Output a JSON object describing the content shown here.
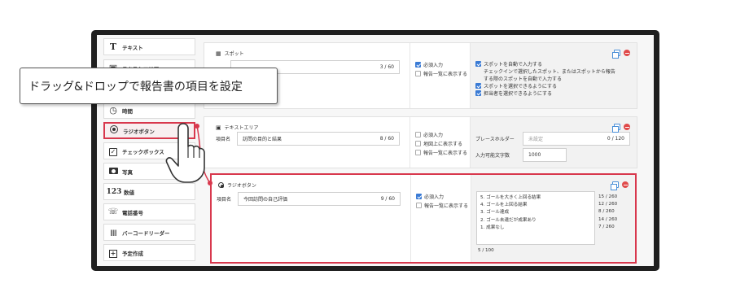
{
  "callout": {
    "text": "ドラッグ&ドロップで報告書の項目を設定"
  },
  "palette": {
    "items": [
      {
        "icon": "text-T-icon",
        "label": "テキスト"
      },
      {
        "icon": "textarea-icon",
        "label": "テキストエリア"
      },
      {
        "icon": "clock-icon",
        "label": "時間"
      },
      {
        "icon": "radio-icon",
        "label": "ラジオボタン"
      },
      {
        "icon": "checkbox-icon",
        "label": "チェックボックス"
      },
      {
        "icon": "camera-icon",
        "label": "写真"
      },
      {
        "icon": "number-icon",
        "label": "数値"
      },
      {
        "icon": "phone-icon",
        "label": "電話番号"
      },
      {
        "icon": "barcode-icon",
        "label": "バーコードリーダー"
      },
      {
        "icon": "schedule-icon",
        "label": "予定作成"
      }
    ],
    "glyphs": {
      "text": "T",
      "number": "123",
      "barcode": "|||||",
      "schedule": "+"
    }
  },
  "spot_card": {
    "title": "スポット",
    "count": "3 / 60",
    "required_label": "必須入力",
    "list_label": "報告一覧に表示する",
    "options": [
      "スポットを自動で入力する",
      "チェックインで選択したスポット、またはスポットから報告",
      "する際のスポットを自動で入力する",
      "スポットを選択できるようにする",
      "担当者を選択できるようにする"
    ]
  },
  "textarea_card": {
    "title": "テキストエリア",
    "item_label": "項目名",
    "item_value": "訪問の目的と結果",
    "count": "8 / 60",
    "required_label": "必須入力",
    "map_label": "地図上に表示する",
    "list_label": "報告一覧に表示する",
    "placeholder_label": "プレースホルダー",
    "placeholder_value": "未設定",
    "placeholder_count": "0 / 120",
    "maxlen_label": "入力可能文字数",
    "maxlen_value": "1000"
  },
  "radio_card": {
    "title": "ラジオボタン",
    "item_label": "項目名",
    "item_value": "今回訪問の自己評価",
    "count": "9 / 60",
    "required_label": "必須入力",
    "list_label": "報告一覧に表示する",
    "choices": [
      {
        "text": "5. ゴールを大きく上回る結果",
        "count": "15 / 260"
      },
      {
        "text": "4. ゴールを上回る結果",
        "count": "12 / 260"
      },
      {
        "text": "3. ゴール達成",
        "count": "8 / 260"
      },
      {
        "text": "2. ゴール未達だが成果あり",
        "count": "14 / 260"
      },
      {
        "text": "1. 成果なし",
        "count": "7 / 260"
      }
    ],
    "total": "5 / 100"
  },
  "colors": {
    "highlight": "#d8384d",
    "checkbox": "#3a7bd5"
  }
}
